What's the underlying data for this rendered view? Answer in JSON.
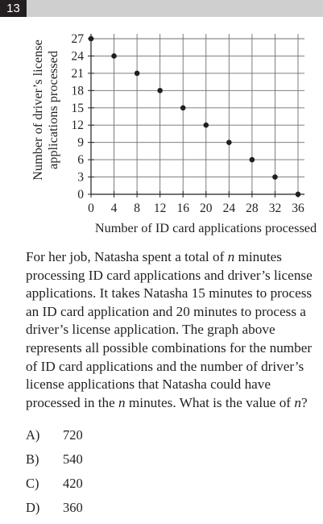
{
  "question_number": "13",
  "chart_data": {
    "type": "scatter",
    "xlabel": "Number of ID card applications processed",
    "ylabel": [
      "Number of driver’s license",
      "applications processed"
    ],
    "x": [
      0,
      4,
      8,
      12,
      16,
      20,
      24,
      28,
      32,
      36
    ],
    "y": [
      27,
      24,
      21,
      18,
      15,
      12,
      9,
      6,
      3,
      0
    ],
    "x_ticks": [
      0,
      4,
      8,
      12,
      16,
      20,
      24,
      28,
      32,
      36
    ],
    "y_ticks": [
      0,
      3,
      6,
      9,
      12,
      15,
      18,
      21,
      24,
      27
    ],
    "xlim": [
      0,
      36
    ],
    "ylim": [
      0,
      27
    ],
    "grid": true,
    "color": "#231f20"
  },
  "question": {
    "stem_parts": [
      "For her job, Natasha spent a total of ",
      "n",
      " minutes processing ID card applications and driver’s license applications. It takes Natasha 15 minutes to process an ID card application and 20 minutes to process a driver’s license application. The graph above represents all possible combinations for the number of ID card applications and the number of driver’s license applications that Natasha could have processed in the ",
      "n",
      " minutes. What is the value of ",
      "n",
      "?"
    ]
  },
  "choices": [
    {
      "letter": "A)",
      "value": "720"
    },
    {
      "letter": "B)",
      "value": "540"
    },
    {
      "letter": "C)",
      "value": "420"
    },
    {
      "letter": "D)",
      "value": "360"
    }
  ]
}
